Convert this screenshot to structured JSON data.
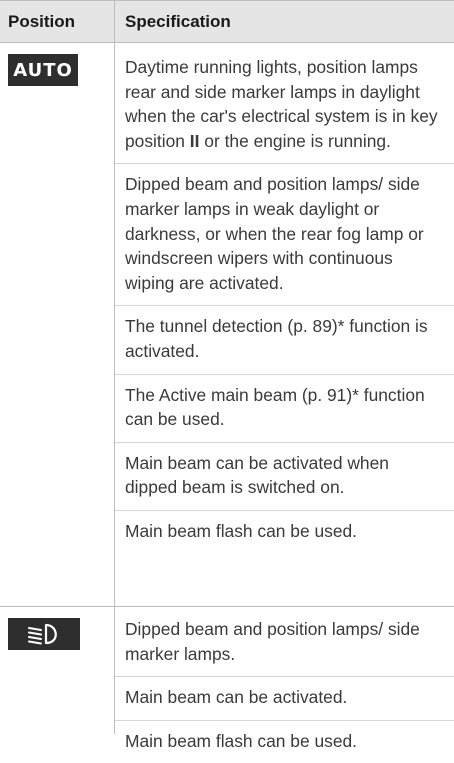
{
  "table": {
    "header": {
      "position": "Position",
      "specification": "Specification"
    },
    "rows": [
      {
        "symbol_text": "AUTO",
        "symbol_icon": "auto-symbol",
        "paragraphs": [
          {
            "before": "Daytime running lights, position lamps rear and side marker lamps in daylight when the car's electrical system is in key position ",
            "bold": "II",
            "after": " or the engine is running."
          },
          {
            "text": "Dipped beam and position lamps/ side marker lamps in weak daylight or darkness, or when the rear fog lamp or windscreen wipers with continuous wiping are activated."
          },
          {
            "text": "The tunnel detection (p. 89)* function is activated."
          },
          {
            "text": "The Active main beam (p. 91)* function can be used."
          },
          {
            "text": "Main beam can be activated when dipped beam is switched on."
          },
          {
            "text": "Main beam flash can be used."
          }
        ]
      },
      {
        "symbol_icon": "dipped-beam-icon",
        "paragraphs": [
          {
            "text": "Dipped beam and position lamps/ side marker lamps."
          },
          {
            "text": "Main beam can be activated."
          },
          {
            "text": "Main beam flash can be used."
          }
        ]
      }
    ]
  },
  "colors": {
    "header_background": "#e5e5e5",
    "symbol_background": "#2e2e2e",
    "divider": "#bdbdbd",
    "text": "#3a3a3a"
  }
}
